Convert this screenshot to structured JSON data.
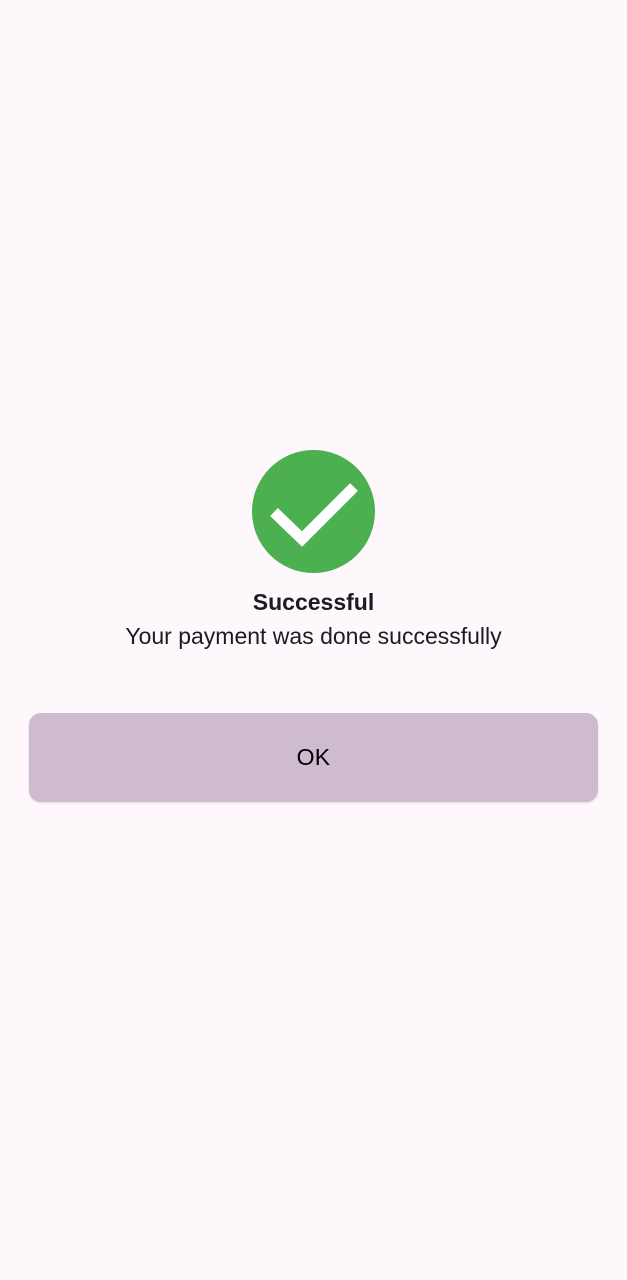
{
  "dialog": {
    "icon": "check-circle-icon",
    "icon_color": "#4caf50",
    "title": "Successful",
    "message": "Your payment was done successfully",
    "ok_label": "OK"
  },
  "colors": {
    "background": "#fef8fc",
    "button": "#cfbbcf",
    "text": "#1d1b20"
  }
}
